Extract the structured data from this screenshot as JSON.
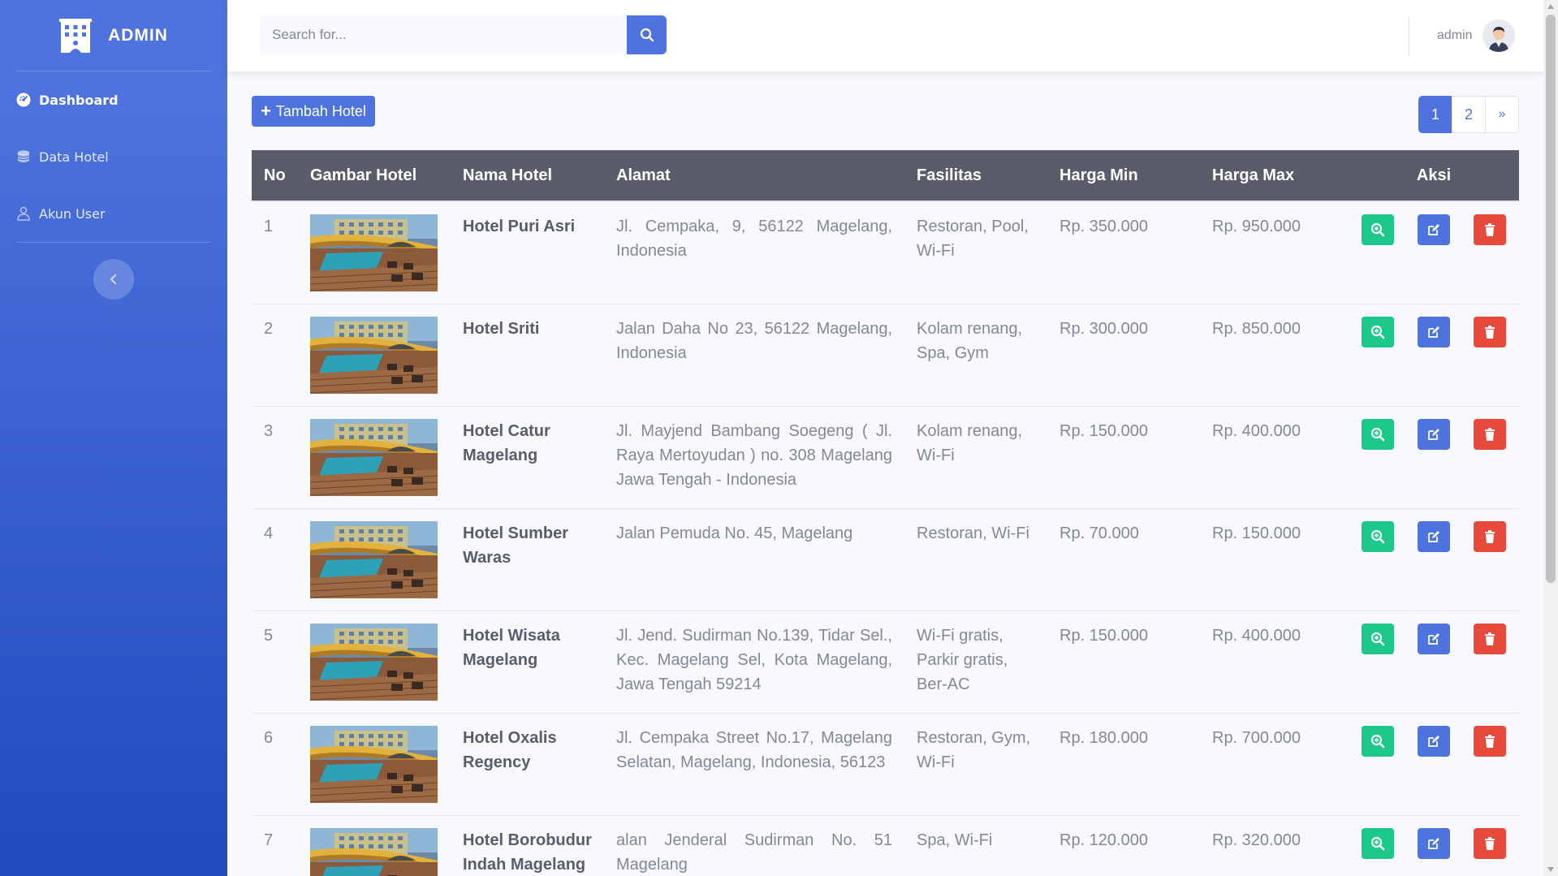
{
  "sidebar": {
    "brand": "ADMIN",
    "items": [
      {
        "label": "Dashboard",
        "icon": "tachometer-icon",
        "active": true
      },
      {
        "label": "Data Hotel",
        "icon": "database-icon",
        "active": false
      },
      {
        "label": "Akun User",
        "icon": "user-icon",
        "active": false
      }
    ],
    "toggle_icon": "chevron-left-icon"
  },
  "topbar": {
    "search_placeholder": "Search for...",
    "search_icon": "search-icon",
    "user_name": "admin"
  },
  "toolbar": {
    "add_label": "Tambah Hotel"
  },
  "pagination": [
    "1",
    "2",
    "»"
  ],
  "pagination_active": "1",
  "table": {
    "headers": [
      "No",
      "Gambar Hotel",
      "Nama Hotel",
      "Alamat",
      "Fasilitas",
      "Harga Min",
      "Harga Max",
      "Aksi"
    ],
    "rows": [
      {
        "no": "1",
        "name": "Hotel Puri Asri",
        "address": "Jl. Cempaka, 9, 56122 Magelang, Indonesia",
        "facilities": "Restoran, Pool, Wi-Fi",
        "min": "Rp. 350.000",
        "max": "Rp. 950.000"
      },
      {
        "no": "2",
        "name": "Hotel Sriti",
        "address": "Jalan Daha No 23, 56122 Magelang, Indonesia",
        "facilities": "Kolam renang, Spa, Gym",
        "min": "Rp. 300.000",
        "max": "Rp. 850.000"
      },
      {
        "no": "3",
        "name": "Hotel Catur Magelang",
        "address": "Jl. Mayjend Bambang Soegeng ( Jl. Raya Mertoyudan ) no. 308 Magelang Jawa Tengah - Indonesia",
        "facilities": "Kolam renang, Wi-Fi",
        "min": "Rp. 150.000",
        "max": "Rp. 400.000"
      },
      {
        "no": "4",
        "name": "Hotel Sumber Waras",
        "address": "Jalan Pemuda No. 45, Magelang",
        "facilities": "Restoran, Wi-Fi",
        "min": "Rp. 70.000",
        "max": "Rp. 150.000"
      },
      {
        "no": "5",
        "name": "Hotel Wisata Magelang",
        "address": "Jl. Jend. Sudirman No.139, Tidar Sel., Kec. Magelang Sel, Kota Magelang, Jawa Tengah 59214",
        "facilities": "Wi-Fi gratis, Parkir gratis, Ber-AC",
        "min": "Rp. 150.000",
        "max": "Rp. 400.000"
      },
      {
        "no": "6",
        "name": "Hotel Oxalis Regency",
        "address": "Jl. Cempaka Street No.17, Magelang Selatan, Magelang, Indonesia, 56123",
        "facilities": "Restoran, Gym, Wi-Fi",
        "min": "Rp. 180.000",
        "max": "Rp. 700.000"
      },
      {
        "no": "7",
        "name": "Hotel Borobudur Indah Magelang",
        "address": "alan Jenderal Sudirman No. 51 Magelang",
        "facilities": "Spa, Wi-Fi",
        "min": "Rp. 120.000",
        "max": "Rp. 320.000"
      }
    ],
    "action_icons": [
      "search-plus-icon",
      "edit-icon",
      "trash-icon"
    ]
  },
  "colors": {
    "primary": "#4e73df",
    "success": "#1cc88a",
    "danger": "#e74a3b",
    "header": "#5a5c69"
  }
}
